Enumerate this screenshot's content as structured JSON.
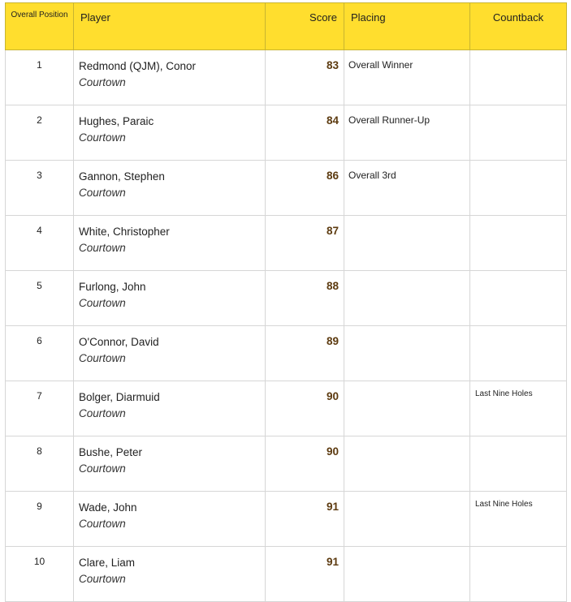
{
  "header": {
    "position": "Overall Position",
    "player": "Player",
    "score": "Score",
    "placing": "Placing",
    "countback": "Countback"
  },
  "rows": [
    {
      "position": "1",
      "name": "Redmond (QJM), Conor",
      "club": "Courtown",
      "score": "83",
      "placing": "Overall Winner",
      "countback": ""
    },
    {
      "position": "2",
      "name": "Hughes, Paraic",
      "club": "Courtown",
      "score": "84",
      "placing": "Overall Runner-Up",
      "countback": ""
    },
    {
      "position": "3",
      "name": "Gannon, Stephen",
      "club": "Courtown",
      "score": "86",
      "placing": "Overall 3rd",
      "countback": ""
    },
    {
      "position": "4",
      "name": "White, Christopher",
      "club": "Courtown",
      "score": "87",
      "placing": "",
      "countback": ""
    },
    {
      "position": "5",
      "name": "Furlong, John",
      "club": "Courtown",
      "score": "88",
      "placing": "",
      "countback": ""
    },
    {
      "position": "6",
      "name": "O'Connor, David",
      "club": "Courtown",
      "score": "89",
      "placing": "",
      "countback": ""
    },
    {
      "position": "7",
      "name": "Bolger, Diarmuid",
      "club": "Courtown",
      "score": "90",
      "placing": "",
      "countback": "Last Nine Holes"
    },
    {
      "position": "8",
      "name": "Bushe, Peter",
      "club": "Courtown",
      "score": "90",
      "placing": "",
      "countback": ""
    },
    {
      "position": "9",
      "name": "Wade, John",
      "club": "Courtown",
      "score": "91",
      "placing": "",
      "countback": "Last Nine Holes"
    },
    {
      "position": "10",
      "name": "Clare, Liam",
      "club": "Courtown",
      "score": "91",
      "placing": "",
      "countback": ""
    }
  ],
  "colors": {
    "header_background": "#ffde2e",
    "score_text": "#5c3a0f",
    "grid_line": "#d6d6d6"
  }
}
